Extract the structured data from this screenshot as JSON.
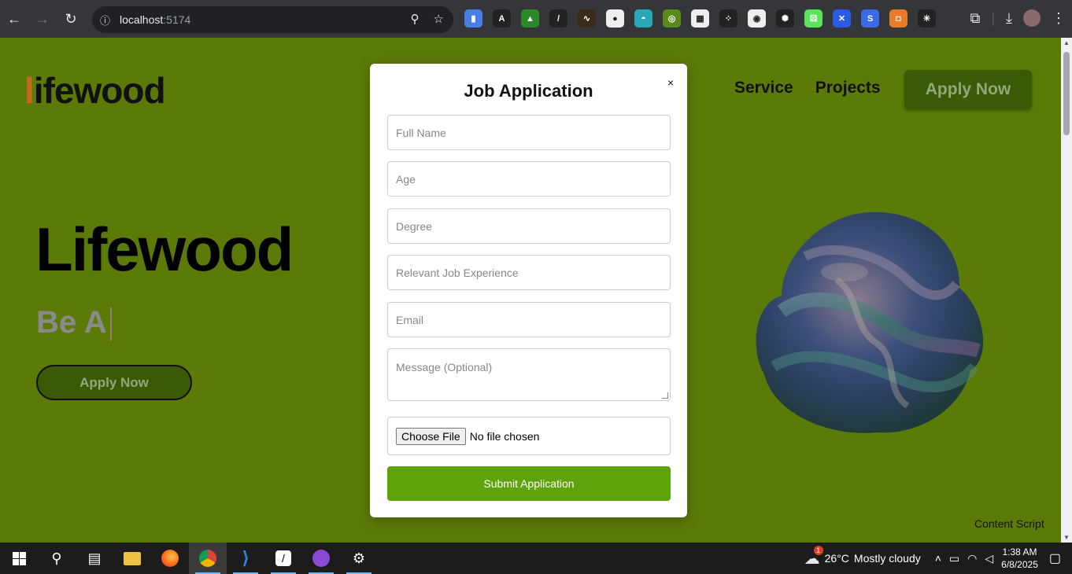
{
  "browser": {
    "url_host": "localhost",
    "url_port": ":5174",
    "extensions": [
      {
        "name": "docs",
        "color": "#4a7ee6",
        "glyph": "▮"
      },
      {
        "name": "a-ext",
        "color": "#222",
        "glyph": "A"
      },
      {
        "name": "chart",
        "color": "#2a8a2a",
        "glyph": "▲"
      },
      {
        "name": "pen",
        "color": "#222",
        "glyph": "/"
      },
      {
        "name": "wave",
        "color": "#3a2a1a",
        "glyph": "∿"
      },
      {
        "name": "game",
        "color": "#eee",
        "glyph": "●"
      },
      {
        "name": "boat",
        "color": "#2aa8b8",
        "glyph": "◓"
      },
      {
        "name": "hex",
        "color": "#5a8a1a",
        "glyph": "◎"
      },
      {
        "name": "grid",
        "color": "#eee",
        "glyph": "▦"
      },
      {
        "name": "dots",
        "color": "#222",
        "glyph": "⁘"
      },
      {
        "name": "circle77",
        "color": "#eee",
        "glyph": "◉"
      },
      {
        "name": "star",
        "color": "#222",
        "glyph": "✺"
      },
      {
        "name": "dice",
        "color": "#5be35b",
        "glyph": "⚄"
      },
      {
        "name": "x",
        "color": "#2a5ae6",
        "glyph": "✕"
      },
      {
        "name": "s",
        "color": "#3a6ae6",
        "glyph": "S"
      },
      {
        "name": "orange",
        "color": "#e87a2a",
        "glyph": "◘"
      },
      {
        "name": "asterisk",
        "color": "#222",
        "glyph": "✳"
      }
    ]
  },
  "header": {
    "logo_prefix": "l",
    "logo_rest": "ifewood",
    "nav": [
      "Service",
      "Projects"
    ],
    "apply_label": "Apply Now"
  },
  "hero": {
    "title": "Lifewood",
    "typing": "Be A",
    "apply_label": "Apply Now"
  },
  "modal": {
    "title": "Job Application",
    "close": "×",
    "fields": [
      {
        "placeholder": "Full Name"
      },
      {
        "placeholder": "Age"
      },
      {
        "placeholder": "Degree"
      },
      {
        "placeholder": "Relevant Job Experience"
      },
      {
        "placeholder": "Email"
      }
    ],
    "message_placeholder": "Message (Optional)",
    "file_button": "Choose File",
    "file_status": "No file chosen",
    "submit_label": "Submit Application"
  },
  "content_script": "Content Script",
  "taskbar": {
    "weather_badge": "1",
    "temperature": "26°C",
    "weather_text": "Mostly cloudy",
    "time": "1:38 AM",
    "date": "6/8/2025"
  },
  "colors": {
    "page_bg": "#5c7a08",
    "submit_bg": "#5ea30a",
    "dark_button": "#3b5a05"
  }
}
